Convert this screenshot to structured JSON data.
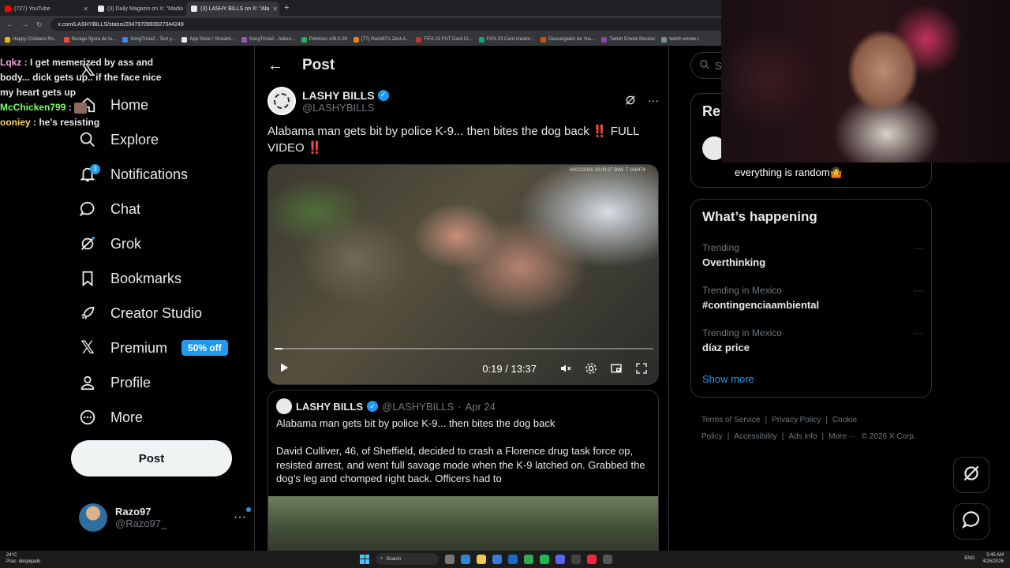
{
  "browser": {
    "tabs": [
      {
        "title": "(727) YouTube",
        "color": "#ff0000"
      },
      {
        "title": "(3) Daily Magazin on X: \"Madio",
        "color": "#e7e9ea"
      },
      {
        "title": "(3) LASHY BILLS on X: \"Ala",
        "color": "#e7e9ea"
      }
    ],
    "url": "x.com/LASHYBILLS/status/2047970993927344249",
    "bookmarks": [
      "Happy Cristiano Ro...",
      "Burago figura de to...",
      "SongTrivia2 - Test y...",
      "App Store / Streami...",
      "SongTrivia2 - Adivin...",
      "Peletoos v26.0.28",
      "(77) Razo97's Zest-A...",
      "FIFA 23 FUT Card Cr...",
      "FIFA 23 Card creator...",
      "Descargador de You...",
      "Twitch Emote Resizer",
      "twitch emote r"
    ]
  },
  "chat": [
    {
      "user": "Lqkz",
      "user_color": "#ff9fe0",
      "text": " : I get memerized by ass and body... dick gets up.. if the face nice my heart gets up"
    },
    {
      "user": "McChicken799",
      "user_color": "#7cff6a",
      "text": " : "
    },
    {
      "user": "ooniey",
      "user_color": "#ffd36a",
      "text": " : he's resisting"
    }
  ],
  "sidebar": {
    "items": [
      {
        "label": "Home",
        "icon": "home-icon"
      },
      {
        "label": "Explore",
        "icon": "search-icon"
      },
      {
        "label": "Notifications",
        "icon": "bell-icon",
        "badge": "3"
      },
      {
        "label": "Chat",
        "icon": "chat-icon"
      },
      {
        "label": "Grok",
        "icon": "grok-icon"
      },
      {
        "label": "Bookmarks",
        "icon": "bookmark-icon"
      },
      {
        "label": "Creator Studio",
        "icon": "rocket-icon"
      },
      {
        "label": "Premium",
        "icon": "x-icon",
        "promo": "50% off"
      },
      {
        "label": "Profile",
        "icon": "person-icon"
      },
      {
        "label": "More",
        "icon": "more-icon"
      }
    ],
    "post_button": "Post",
    "account": {
      "name": "Razo97",
      "handle": "@Razo97_"
    }
  },
  "main": {
    "title": "Post",
    "author": {
      "name": "LASHY BILLS",
      "handle": "@LASHYBILLS"
    },
    "text": "Alabama man gets bit by police K-9... then bites the dog back",
    "text_tail": "FULL VIDEO",
    "red_marks": "‼️",
    "video": {
      "time": "0:19 / 13:37",
      "progress": 0.02,
      "stamp": "04/22/2026 19:03:27   BWL T 168474"
    },
    "quote": {
      "name": "LASHY BILLS",
      "handle": "@LASHYBILLS",
      "date": "Apr 24",
      "line": "Alabama man gets bit by police K-9... then bites the dog back",
      "body": "David Culliver, 46, of Sheffield, decided to crash a Florence drug task force op, resisted arrest, and went full savage mode when the K-9 latched on. Grabbed the dog’s leg and chomped right back. Officers had to"
    }
  },
  "right": {
    "search_placeholder": "Se",
    "relevant_title": "Rel",
    "happening_title": "What’s happening",
    "trends": [
      {
        "meta": "Trending",
        "name": "Overthinking"
      },
      {
        "meta": "Trending in Mexico",
        "name": "#contingenciaambiental"
      },
      {
        "meta": "Trending in Mexico",
        "name": "díaz price"
      }
    ],
    "show_more": "Show more",
    "footer": [
      "Terms of Service",
      "|",
      "Privacy Policy",
      "|",
      "Cookie Policy",
      "|",
      "Accessibility",
      "|",
      "Ads info",
      "|",
      "More ···",
      "© 2026 X Corp."
    ]
  },
  "webcam": {
    "caption": "everything is random🤷"
  },
  "taskbar": {
    "weather_temp": "24°C",
    "weather_text": "Prac. despejado",
    "search": "Search",
    "lang": "ENG",
    "time": "3:45 AM",
    "date": "4/26/2026"
  },
  "colors": {
    "accent": "#1d9bf0",
    "background": "#000000",
    "border": "#2f3336",
    "muted": "#71767b"
  }
}
